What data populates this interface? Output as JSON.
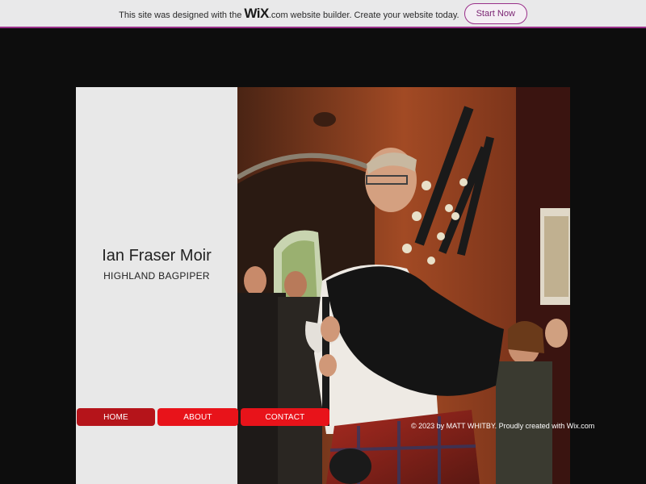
{
  "banner": {
    "text_before": "This site was designed with the",
    "logo": "WiX",
    "logo_suffix": ".com",
    "text_after": "website builder. Create your website today.",
    "cta_label": "Start Now",
    "accent_color": "#9a2f8a"
  },
  "hero": {
    "name": "Ian Fraser Moir",
    "subtitle": "HIGHLAND BAGPIPER",
    "photo_alt": "bagpiper-photo"
  },
  "nav": {
    "items": [
      {
        "label": "HOME"
      },
      {
        "label": "ABOUT"
      },
      {
        "label": "CONTACT"
      }
    ],
    "active_color": "#b5141a",
    "color": "#e8131a"
  },
  "footer": {
    "text": "© 2023 by MATT WHITBY. Proudly created with Wix.com"
  }
}
